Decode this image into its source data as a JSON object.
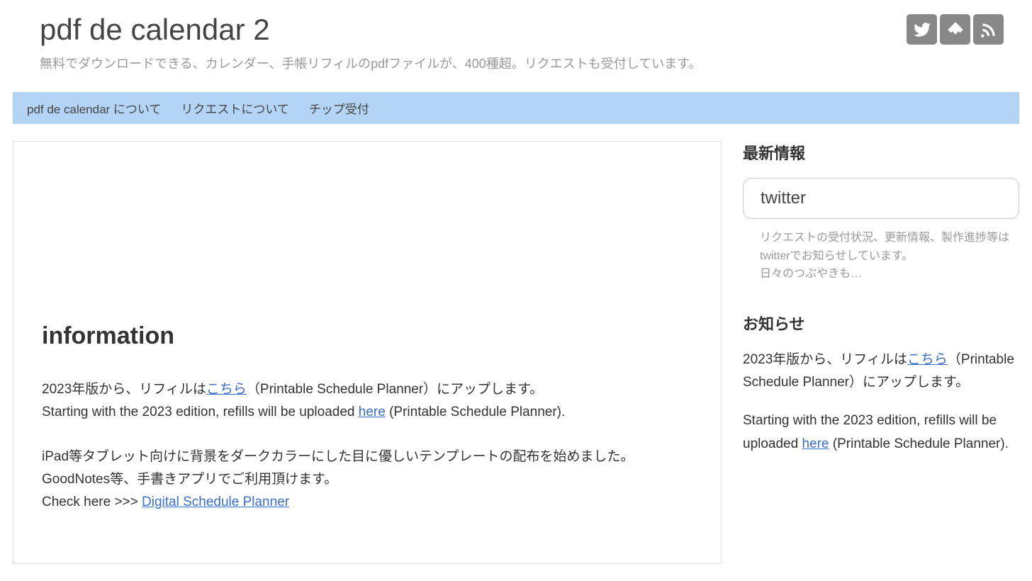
{
  "header": {
    "title": "pdf de calendar 2",
    "subtitle": "無料でダウンロードできる、カレンダー、手帳リフィルのpdfファイルが、400種超。リクエストも受付しています。"
  },
  "nav": {
    "items": [
      "pdf de calendar について",
      "リクエストについて",
      "チップ受付"
    ]
  },
  "main": {
    "heading": "information",
    "para1_prefix": "2023年版から、リフィルは",
    "para1_link1": "こちら",
    "para1_mid1": "（Printable Schedule Planner）にアップします。",
    "para1_line2_prefix": "Starting with the 2023 edition, refills will be uploaded ",
    "para1_link2": "here",
    "para1_line2_suffix": " (Printable Schedule Planner).",
    "para2_line1": "iPad等タブレット向けに背景をダークカラーにした目に優しいテンプレートの配布を始めました。GoodNotes等、手書きアプリでご利用頂けます。",
    "para2_line2_prefix": "Check here >>> ",
    "para2_link": "Digital Schedule Planner"
  },
  "sidebar": {
    "latest_heading": "最新情報",
    "twitter_label": "twitter",
    "twitter_desc_line1": "リクエストの受付状況、更新情報、製作進捗等はtwitterでお知らせしています。",
    "twitter_desc_line2": "日々のつぶやきも…",
    "notice_heading": "お知らせ",
    "notice1_prefix": "2023年版から、リフィルは",
    "notice1_link": "こちら",
    "notice1_suffix": "（Printable Schedule Planner）にアップします。",
    "notice2_prefix": "Starting with the 2023 edition, refills will be uploaded ",
    "notice2_link": "here",
    "notice2_suffix": " (Printable Schedule Planner)."
  }
}
